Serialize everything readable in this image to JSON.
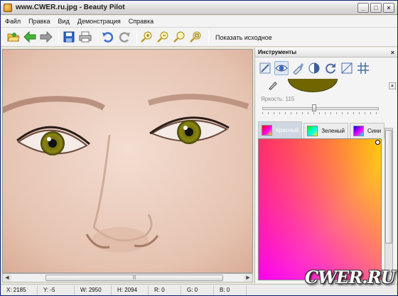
{
  "window": {
    "title": "www.CWER.ru.jpg - Beauty Pilot",
    "buttons": [
      "_",
      "□",
      "×"
    ]
  },
  "menu": {
    "items": [
      "Файл",
      "Правка",
      "Вид",
      "Демонстрация",
      "Справка"
    ]
  },
  "toolbar": {
    "icons": [
      "open-icon",
      "back-icon",
      "forward-icon",
      "save-icon",
      "print-icon",
      "undo-icon",
      "redo-icon",
      "zoom-in-icon",
      "zoom-out-icon",
      "zoom-fit-icon",
      "zoom-actual-icon"
    ],
    "show_original_label": "Показать исходное"
  },
  "tools_panel": {
    "title": "Инструменты",
    "close": "×",
    "tool_icons": [
      "skin-brush-icon",
      "eye-icon",
      "lipstick-icon",
      "contrast-icon",
      "rotate-icon",
      "crop-icon",
      "grid-icon"
    ],
    "active_tool": "eye-icon",
    "brightness_label": "Яркость: 115",
    "brightness_value": 115,
    "color_tabs": [
      {
        "label": "Красный",
        "active": true
      },
      {
        "label": "Зеленый",
        "active": false
      },
      {
        "label": "Сини",
        "active": false
      }
    ],
    "selected_color": "#706600"
  },
  "canvas": {
    "scroll_thumb_label": "|||"
  },
  "status": {
    "x": "X: 2185",
    "y": "Y: -5",
    "w": "W: 2950",
    "h": "H: 2094",
    "r": "R: 0",
    "g": "G: 0",
    "b": "B: 0"
  },
  "watermark": "CWER.RU"
}
